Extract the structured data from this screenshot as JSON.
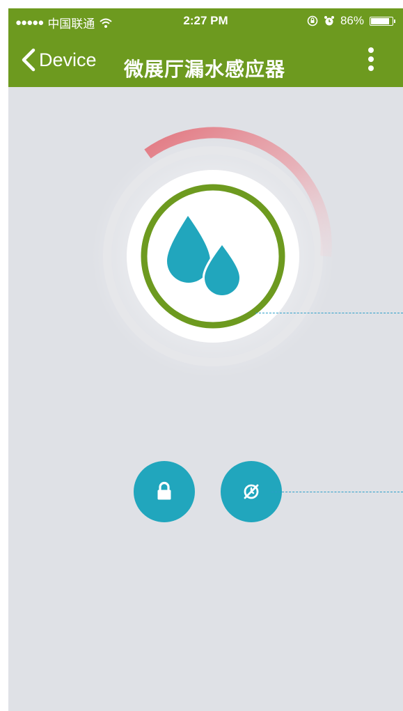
{
  "status_bar": {
    "signal": "●●●●●",
    "carrier": "中国联通",
    "time": "2:27 PM",
    "battery": "86%",
    "battery_level": 0.86
  },
  "nav": {
    "back_label": "Device",
    "title": "微展厅漏水感应器"
  },
  "device": {
    "sensor_icon": "water-drops-icon",
    "ring_colors": {
      "accent": "#e27780",
      "status": "#6d9a1f",
      "icon": "#21a6bd"
    }
  },
  "controls": [
    {
      "name": "lock-button",
      "icon": "lock-icon"
    },
    {
      "name": "alarm-off-button",
      "icon": "alarm-off-icon"
    }
  ],
  "colors": {
    "brand": "#6d9a1f",
    "background": "#dfe1e6",
    "teal": "#21a6bd"
  }
}
